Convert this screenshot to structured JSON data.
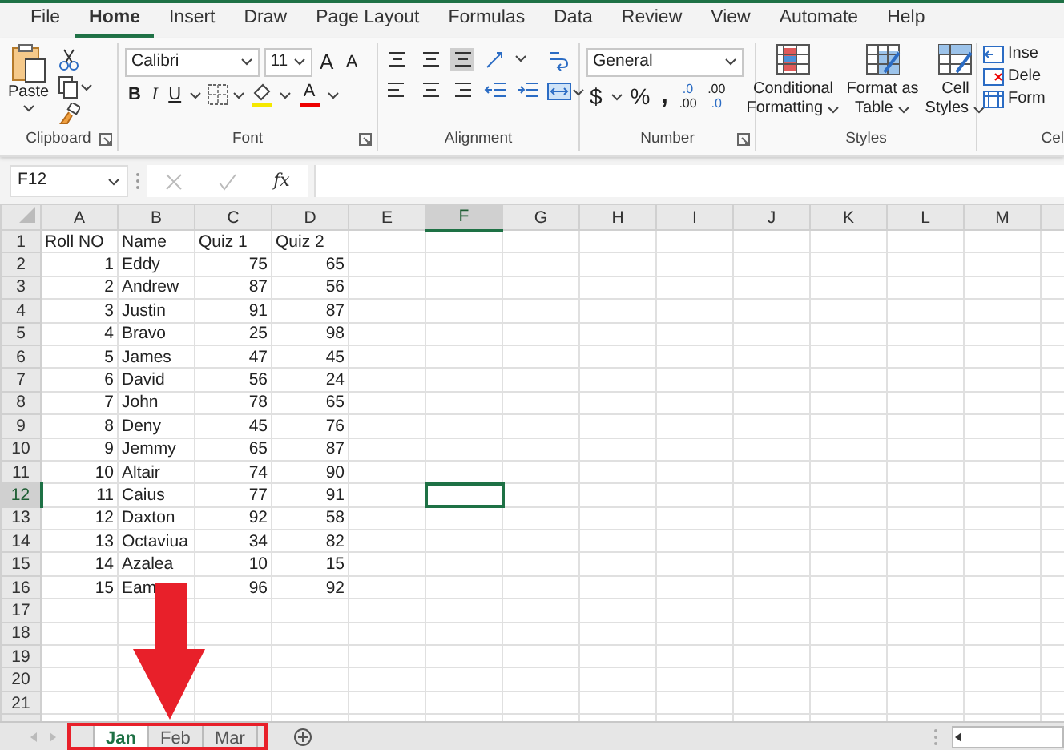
{
  "menu_tabs": [
    {
      "label": "File",
      "selected": false
    },
    {
      "label": "Home",
      "selected": true
    },
    {
      "label": "Insert",
      "selected": false
    },
    {
      "label": "Draw",
      "selected": false
    },
    {
      "label": "Page Layout",
      "selected": false
    },
    {
      "label": "Formulas",
      "selected": false
    },
    {
      "label": "Data",
      "selected": false
    },
    {
      "label": "Review",
      "selected": false
    },
    {
      "label": "View",
      "selected": false
    },
    {
      "label": "Automate",
      "selected": false
    },
    {
      "label": "Help",
      "selected": false
    }
  ],
  "ribbon": {
    "clipboard": {
      "paste": "Paste",
      "label": "Clipboard"
    },
    "font": {
      "font_name": "Calibri",
      "font_size": "11",
      "grow": "A",
      "shrink": "A",
      "bold": "B",
      "italic": "I",
      "underline": "U",
      "font_color": "A",
      "label": "Font"
    },
    "alignment": {
      "label": "Alignment"
    },
    "number": {
      "format": "General",
      "currency": "$",
      "percent": "%",
      "comma": ",",
      "increase_decimal": [
        ".0",
        ".00"
      ],
      "decrease_decimal": [
        ".00",
        ".0"
      ],
      "label": "Number"
    },
    "styles": {
      "buttons": [
        {
          "line1": "Conditional",
          "line2": "Formatting"
        },
        {
          "line1": "Format as",
          "line2": "Table"
        },
        {
          "line1": "Cell",
          "line2": "Styles"
        }
      ],
      "label": "Styles"
    },
    "cells": {
      "items": [
        "Inse",
        "Dele",
        "Form"
      ],
      "label": "Cel"
    }
  },
  "formula_bar": {
    "name_box": "F12",
    "function_label": "fx"
  },
  "sheet": {
    "columns": [
      {
        "letter": "A",
        "selected": false
      },
      {
        "letter": "B",
        "selected": false
      },
      {
        "letter": "C",
        "selected": false
      },
      {
        "letter": "D",
        "selected": false
      },
      {
        "letter": "E",
        "selected": false
      },
      {
        "letter": "F",
        "selected": true
      },
      {
        "letter": "G",
        "selected": false
      },
      {
        "letter": "H",
        "selected": false
      },
      {
        "letter": "I",
        "selected": false
      },
      {
        "letter": "J",
        "selected": false
      },
      {
        "letter": "K",
        "selected": false
      },
      {
        "letter": "L",
        "selected": false
      },
      {
        "letter": "M",
        "selected": false
      }
    ],
    "rows": [
      {
        "number": "1",
        "selected": false,
        "kind": "labels",
        "cells": [
          "Roll NO",
          "Name",
          "Quiz 1",
          "Quiz 2"
        ]
      },
      {
        "number": "2",
        "selected": false,
        "kind": "values",
        "cells": [
          "1",
          "Eddy",
          "75",
          "65"
        ]
      },
      {
        "number": "3",
        "selected": false,
        "kind": "values",
        "cells": [
          "2",
          "Andrew",
          "87",
          "56"
        ]
      },
      {
        "number": "4",
        "selected": false,
        "kind": "values",
        "cells": [
          "3",
          "Justin",
          "91",
          "87"
        ]
      },
      {
        "number": "5",
        "selected": false,
        "kind": "values",
        "cells": [
          "4",
          "Bravo",
          "25",
          "98"
        ]
      },
      {
        "number": "6",
        "selected": false,
        "kind": "values",
        "cells": [
          "5",
          "James",
          "47",
          "45"
        ]
      },
      {
        "number": "7",
        "selected": false,
        "kind": "values",
        "cells": [
          "6",
          "David",
          "56",
          "24"
        ]
      },
      {
        "number": "8",
        "selected": false,
        "kind": "values",
        "cells": [
          "7",
          "John",
          "78",
          "65"
        ]
      },
      {
        "number": "9",
        "selected": false,
        "kind": "values",
        "cells": [
          "8",
          "Deny",
          "45",
          "76"
        ]
      },
      {
        "number": "10",
        "selected": false,
        "kind": "values",
        "cells": [
          "9",
          "Jemmy",
          "65",
          "87"
        ]
      },
      {
        "number": "11",
        "selected": false,
        "kind": "values",
        "cells": [
          "10",
          "Altair",
          "74",
          "90"
        ]
      },
      {
        "number": "12",
        "selected": true,
        "kind": "values",
        "cells": [
          "11",
          "Caius",
          "77",
          "91"
        ]
      },
      {
        "number": "13",
        "selected": false,
        "kind": "values",
        "cells": [
          "12",
          "Daxton",
          "92",
          "58"
        ]
      },
      {
        "number": "14",
        "selected": false,
        "kind": "values",
        "cells": [
          "13",
          "Octaviua",
          "34",
          "82"
        ]
      },
      {
        "number": "15",
        "selected": false,
        "kind": "values",
        "cells": [
          "14",
          "Azalea",
          "10",
          "15"
        ]
      },
      {
        "number": "16",
        "selected": false,
        "kind": "values",
        "cells": [
          "15",
          "Eam",
          "96",
          "92"
        ]
      },
      {
        "number": "17",
        "selected": false,
        "cells": []
      },
      {
        "number": "18",
        "selected": false,
        "cells": []
      },
      {
        "number": "19",
        "selected": false,
        "cells": []
      },
      {
        "number": "20",
        "selected": false,
        "cells": []
      },
      {
        "number": "21",
        "selected": false,
        "cells": []
      }
    ]
  },
  "sheet_tabs": [
    {
      "label": "Jan",
      "selected": true
    },
    {
      "label": "Feb",
      "selected": false
    },
    {
      "label": "Mar",
      "selected": false
    }
  ],
  "callout": {
    "arrow": true,
    "highlight_box": true
  }
}
